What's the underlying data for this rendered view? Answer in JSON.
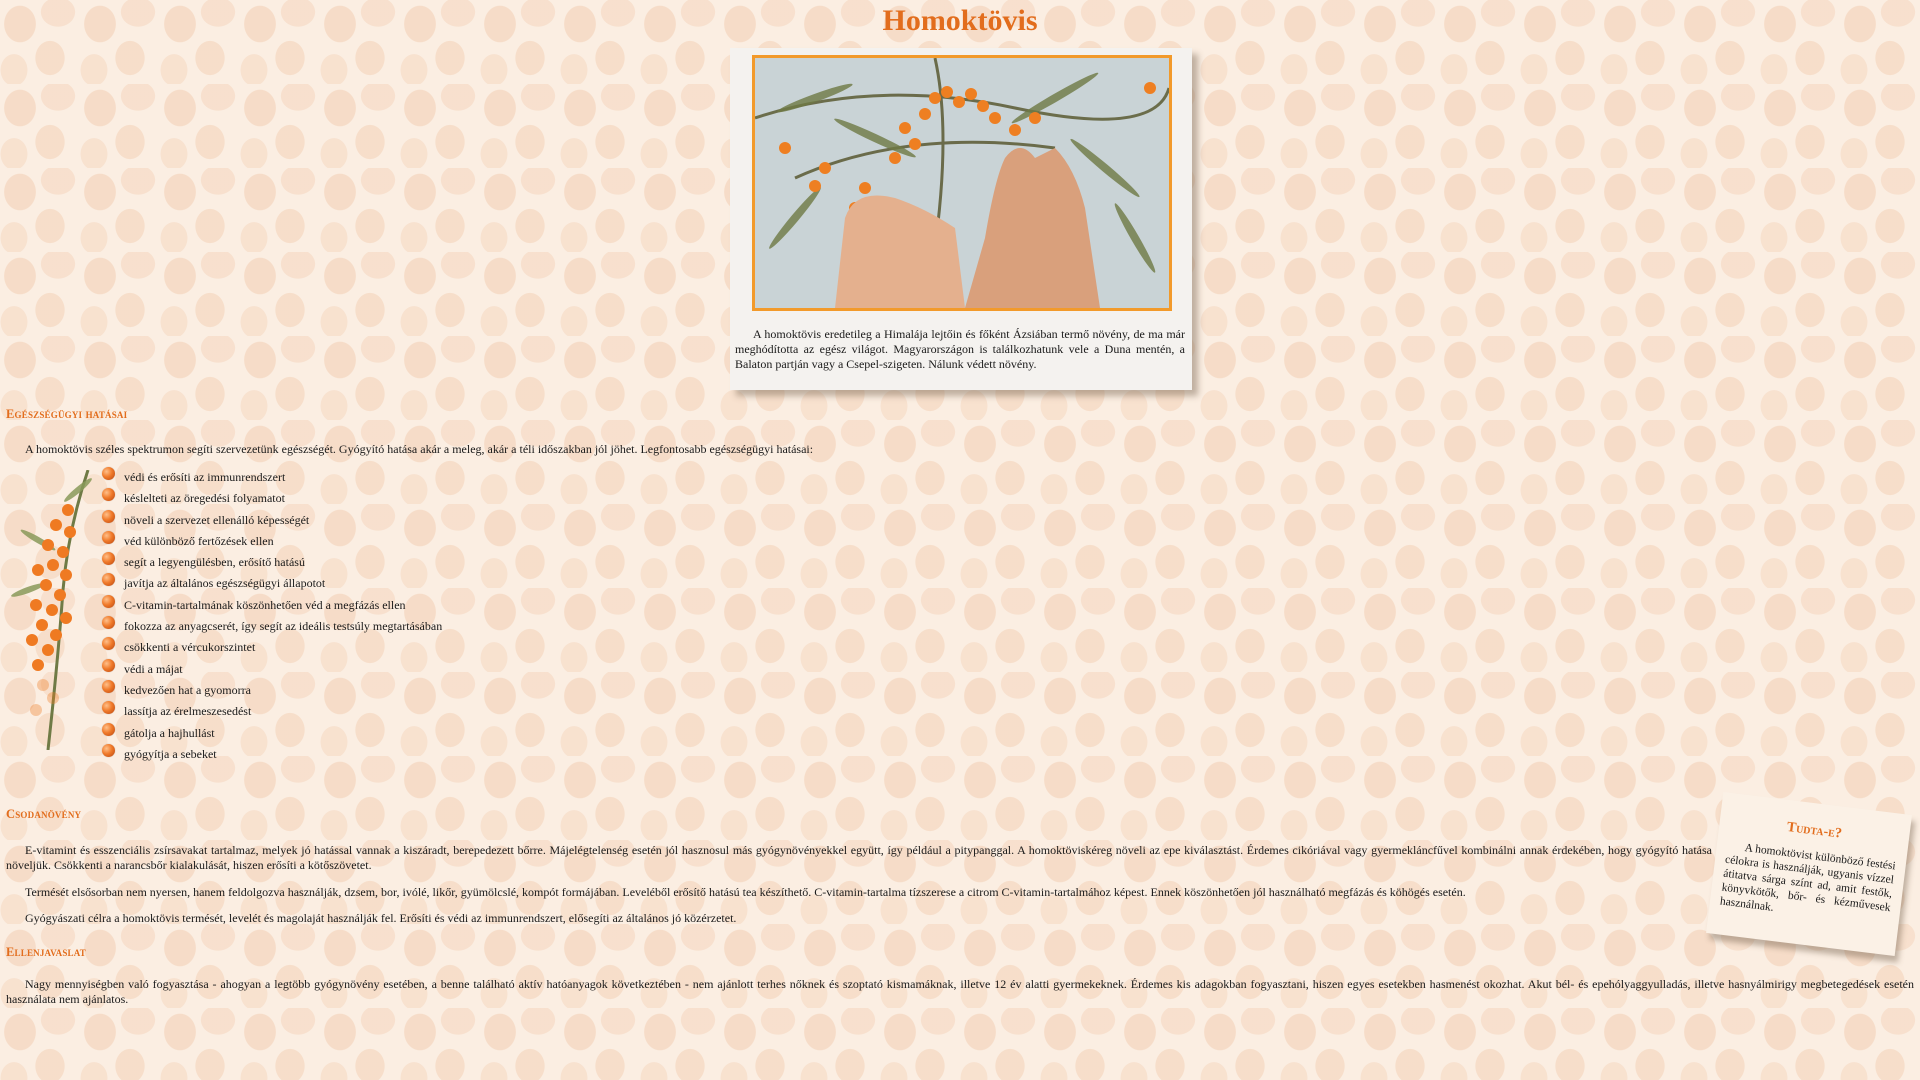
{
  "page": {
    "title": "Homoktövis"
  },
  "photo": {
    "alt": "hands picking sea buckthorn berries",
    "caption": "A homoktövis eredetileg a Himalája lejtőin és főként Ázsiában termő növény, de ma már meghódította az egész világot. Magyarországon is találkozhatunk vele a Duna mentén, a Balaton partján vagy a Csepel-szigeten. Nálunk védett növény."
  },
  "health": {
    "heading": "Egészségügyi hatásai",
    "intro": "A homoktövis széles spektrumon segíti szervezetünk egészségét. Gyógyító hatása akár a meleg, akár a téli időszakban jól jöhet. Legfontosabb egészségügyi hatásai:",
    "benefits": [
      "védi és erősíti az immunrendszert",
      "késlelteti az öregedési folyamatot",
      "növeli a szervezet ellenálló képességét",
      "véd különböző fertőzések ellen",
      "segít a legyengülésben, erősítő hatású",
      "javítja az általános egészségügyi állapotot",
      "C-vitamin-tartalmának köszönhetően véd a megfázás ellen",
      "fokozza az anyagcserét, így segít az ideális testsúly megtartásában",
      "csökkenti a vércukorszintet",
      "védi a májat",
      "kedvezően hat a gyomorra",
      "lassítja az érelmeszesedést",
      "gátolja a hajhullást",
      "gyógyítja a sebeket"
    ]
  },
  "wonder": {
    "heading": "Csodanövény",
    "paragraphs": [
      "E-vitamint és esszenciális zsírsavakat tartalmaz, melyek jó hatással vannak a kiszáradt, berepedezett bőrre. Májelégtelenség esetén jól hasznosul más gyógynövényekkel együtt, így például a pitypanggal. A homoktöviskéreg növeli az epe kiválasztást. Érdemes cikóriával vagy gyermekláncfűvel kombinálni annak érdekében, hogy gyógyító hatása növeljük. Csökkenti a narancsbőr kialakulását, hiszen erősíti a kötőszövetet.",
      "Termését elsősorban nem nyersen, hanem feldolgozva használják, dzsem, bor, ivólé, likőr, gyümölcslé, kompót formájában. Leveléből erősítő hatású tea készíthető. C-vitamin-tartalma tízszerese a citrom C-vitamin-tartalmához képest. Ennek köszönhetően jól használható megfázás és köhögés esetén.",
      "Gyógyászati célra a homoktövis termését, levelét és magolaját használják fel. Erősíti és védi az immunrendszert, elősegíti az általános jó közérzetet."
    ]
  },
  "contra": {
    "heading": "Ellenjavaslat",
    "text": "Nagy mennyiségben való fogyasztása - ahogyan a legtöbb gyógynövény esetében, a benne található aktív hatóanyagok következtében - nem ajánlott terhes nőknek és szoptató kismamáknak, illetve 12 év alatti gyermekeknek. Érdemes kis adagokban fogyasztani, hiszen egyes esetekben hasmenést okozhat. Akut bél- és epehólyaggyulladás, illetve hasnyálmirigy megbetegedések esetén használata nem ajánlatos."
  },
  "tip": {
    "heading": "Tudta-e?",
    "text": "A homoktövist különböző festési célokra is használják, ugyanis vízzel átitatva sárga színt ad, amit festők, könyvkötők, bőr- és kézművesek használnak."
  },
  "colors": {
    "accent": "#e26d1d",
    "photo_border": "#f29a2b",
    "background": "#fbeee2"
  }
}
